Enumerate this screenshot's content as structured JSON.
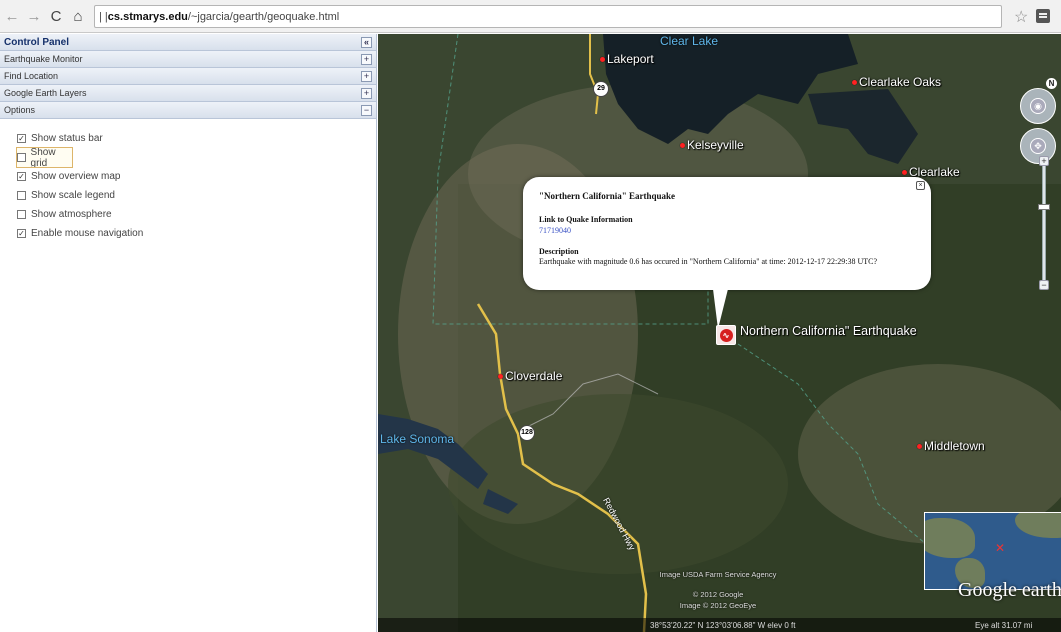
{
  "browser": {
    "back_icon": "arrow-left-icon",
    "forward_icon": "arrow-right-icon",
    "reload_icon": "reload-icon",
    "home_icon": "home-icon",
    "url_host": "cs.stmarys.edu",
    "url_rest": "/~jgarcia/gearth/geoquake.html",
    "url_prefix": "| | ",
    "star_icon": "bookmark-star-icon",
    "menu_icon": "menu-icon"
  },
  "panel": {
    "title": "Control Panel",
    "sections": [
      {
        "label": "Earthquake Monitor",
        "toggle": "+"
      },
      {
        "label": "Find Location",
        "toggle": "+"
      },
      {
        "label": "Google Earth Layers",
        "toggle": "+"
      },
      {
        "label": "Options",
        "toggle": "−"
      }
    ],
    "options": [
      {
        "label": "Show status bar",
        "checked": true
      },
      {
        "label": "Show grid",
        "checked": false
      },
      {
        "label": "Show overview map",
        "checked": true
      },
      {
        "label": "Show scale legend",
        "checked": false
      },
      {
        "label": "Show atmosphere",
        "checked": false
      },
      {
        "label": "Enable mouse navigation",
        "checked": true
      }
    ]
  },
  "map": {
    "places": [
      {
        "name": "Lakeport"
      },
      {
        "name": "Clearlake Oaks"
      },
      {
        "name": "Kelseyville"
      },
      {
        "name": "Clearlake"
      },
      {
        "name": "Cloverdale"
      },
      {
        "name": "Middletown"
      }
    ],
    "water": [
      {
        "name": "Clear Lake"
      },
      {
        "name": "Lake Sonoma"
      }
    ],
    "shields": [
      "29",
      "128"
    ],
    "road_label": "Redwood Hwy",
    "earthquake_label": "Northern California\" Earthquake",
    "balloon": {
      "title": "\"Northern California\" Earthquake",
      "link_heading": "Link to Quake Information",
      "link_text": "71719040",
      "desc_heading": "Description",
      "desc_text": "Earthquake with magnitude 0.6 has occured in \"Northern California\" at time: 2012-12-17 22:29:38 UTC?"
    },
    "compass_label": "N",
    "credits": [
      "Image USDA Farm Service Agency",
      "© 2012 Google",
      "Image © 2012 GeoEye"
    ],
    "logo": "Google earth",
    "status_left": "38°53'20.22\" N 123°03'06.88\" W elev 0 ft",
    "status_right": "Eye alt 31.07 mi"
  }
}
